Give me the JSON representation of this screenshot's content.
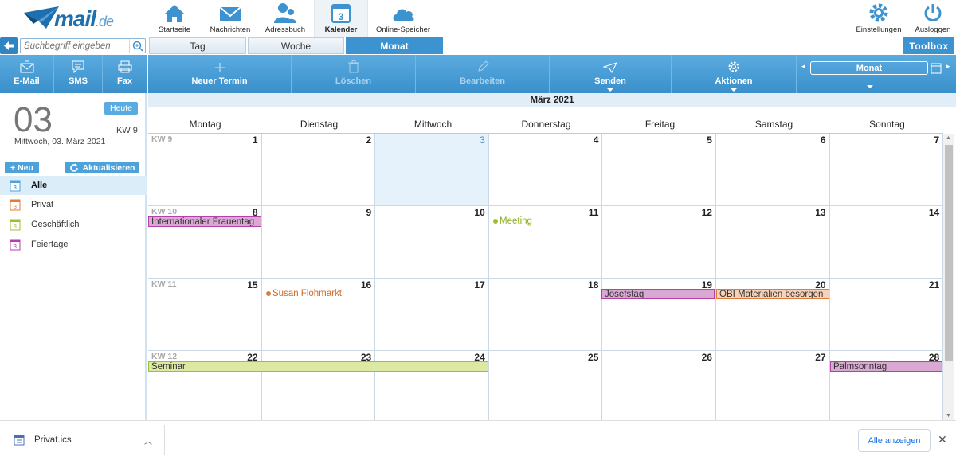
{
  "nav": {
    "items": [
      {
        "label": "Startseite",
        "icon": "home-icon"
      },
      {
        "label": "Nachrichten",
        "icon": "envelope-icon"
      },
      {
        "label": "Adressbuch",
        "icon": "contacts-icon"
      },
      {
        "label": "Kalender",
        "icon": "calendar-icon",
        "badge": "3"
      },
      {
        "label": "Online-Speicher",
        "icon": "cloud-icon"
      }
    ],
    "settings_label": "Einstellungen",
    "logout_label": "Ausloggen"
  },
  "logo": {
    "word": "mail",
    "tld": ".de"
  },
  "search": {
    "placeholder": "Suchbegriff eingeben"
  },
  "view_tabs": [
    "Tag",
    "Woche",
    "Monat"
  ],
  "toolbox_label": "Toolbox",
  "left_actions": [
    "E-Mail",
    "SMS",
    "Fax"
  ],
  "toolbar": {
    "new": "Neuer Termin",
    "delete": "Löschen",
    "edit": "Bearbeiten",
    "send": "Senden",
    "actions": "Aktionen",
    "view_select": "Monat"
  },
  "sidebar": {
    "day": "03",
    "today_button": "Heute",
    "week": "KW 9",
    "date_text": "Mittwoch, 03. März 2021",
    "new_button": "+ Neu",
    "refresh_button": "Aktualisieren",
    "calendars": [
      {
        "label": "Alle",
        "color": "#4ea2dc"
      },
      {
        "label": "Privat",
        "color": "#e07b39"
      },
      {
        "label": "Geschäftlich",
        "color": "#9dc12e"
      },
      {
        "label": "Feiertage",
        "color": "#b540a8"
      }
    ]
  },
  "calendar": {
    "month_title": "März 2021",
    "weekdays": [
      "Montag",
      "Dienstag",
      "Mittwoch",
      "Donnerstag",
      "Freitag",
      "Samstag",
      "Sonntag"
    ],
    "weeks": [
      {
        "kw": "KW 9",
        "days": [
          "1",
          "2",
          "3",
          "4",
          "5",
          "6",
          "7"
        ]
      },
      {
        "kw": "KW 10",
        "days": [
          "8",
          "9",
          "10",
          "11",
          "12",
          "13",
          "14"
        ]
      },
      {
        "kw": "KW 11",
        "days": [
          "15",
          "16",
          "17",
          "18",
          "19",
          "20",
          "21"
        ]
      },
      {
        "kw": "KW 12",
        "days": [
          "22",
          "23",
          "24",
          "25",
          "26",
          "27",
          "28"
        ]
      }
    ],
    "today": "3",
    "events": [
      {
        "title": "Internationaler Frauentag",
        "type": "bar",
        "color": "#d9a8d3",
        "border": "#b540a8"
      },
      {
        "title": "Meeting",
        "type": "dot",
        "color": "#9dc12e"
      },
      {
        "title": "Susan Flohmarkt",
        "type": "dot",
        "color": "#e07b39"
      },
      {
        "title": "Josefstag",
        "type": "bar",
        "color": "#d9a8d3",
        "border": "#b540a8"
      },
      {
        "title": "OBI Materialien besorgen",
        "type": "bar",
        "color": "#f8d2b8",
        "border": "#e07b39"
      },
      {
        "title": "Seminar",
        "type": "bar",
        "color": "#dbe9a3",
        "border": "#9dc12e"
      },
      {
        "title": "Palmsonntag",
        "type": "bar",
        "color": "#d9a8d3",
        "border": "#b540a8"
      }
    ]
  },
  "download": {
    "file": "Privat.ics",
    "show_all": "Alle anzeigen"
  }
}
